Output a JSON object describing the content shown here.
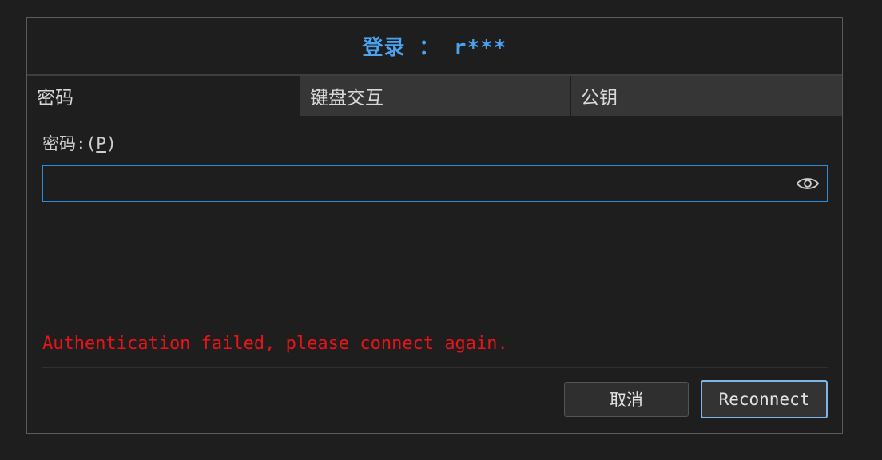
{
  "dialog": {
    "title": "登录 ： r***"
  },
  "tabs": [
    {
      "label": "密码",
      "active": true
    },
    {
      "label": "键盘交互",
      "active": false
    },
    {
      "label": "公钥",
      "active": false
    }
  ],
  "password": {
    "label_prefix": "密码:(",
    "label_mnemonic": "P",
    "label_suffix": ")",
    "value": "",
    "placeholder": "",
    "toggle_icon": "eye-icon"
  },
  "error_message": "Authentication failed, please connect again.",
  "buttons": {
    "cancel": "取消",
    "reconnect": "Reconnect"
  },
  "colors": {
    "title": "#4aa3f0",
    "error": "#e8141a",
    "input_focus_border": "#2b8ddb",
    "primary_button_border": "#7fb4e8"
  }
}
